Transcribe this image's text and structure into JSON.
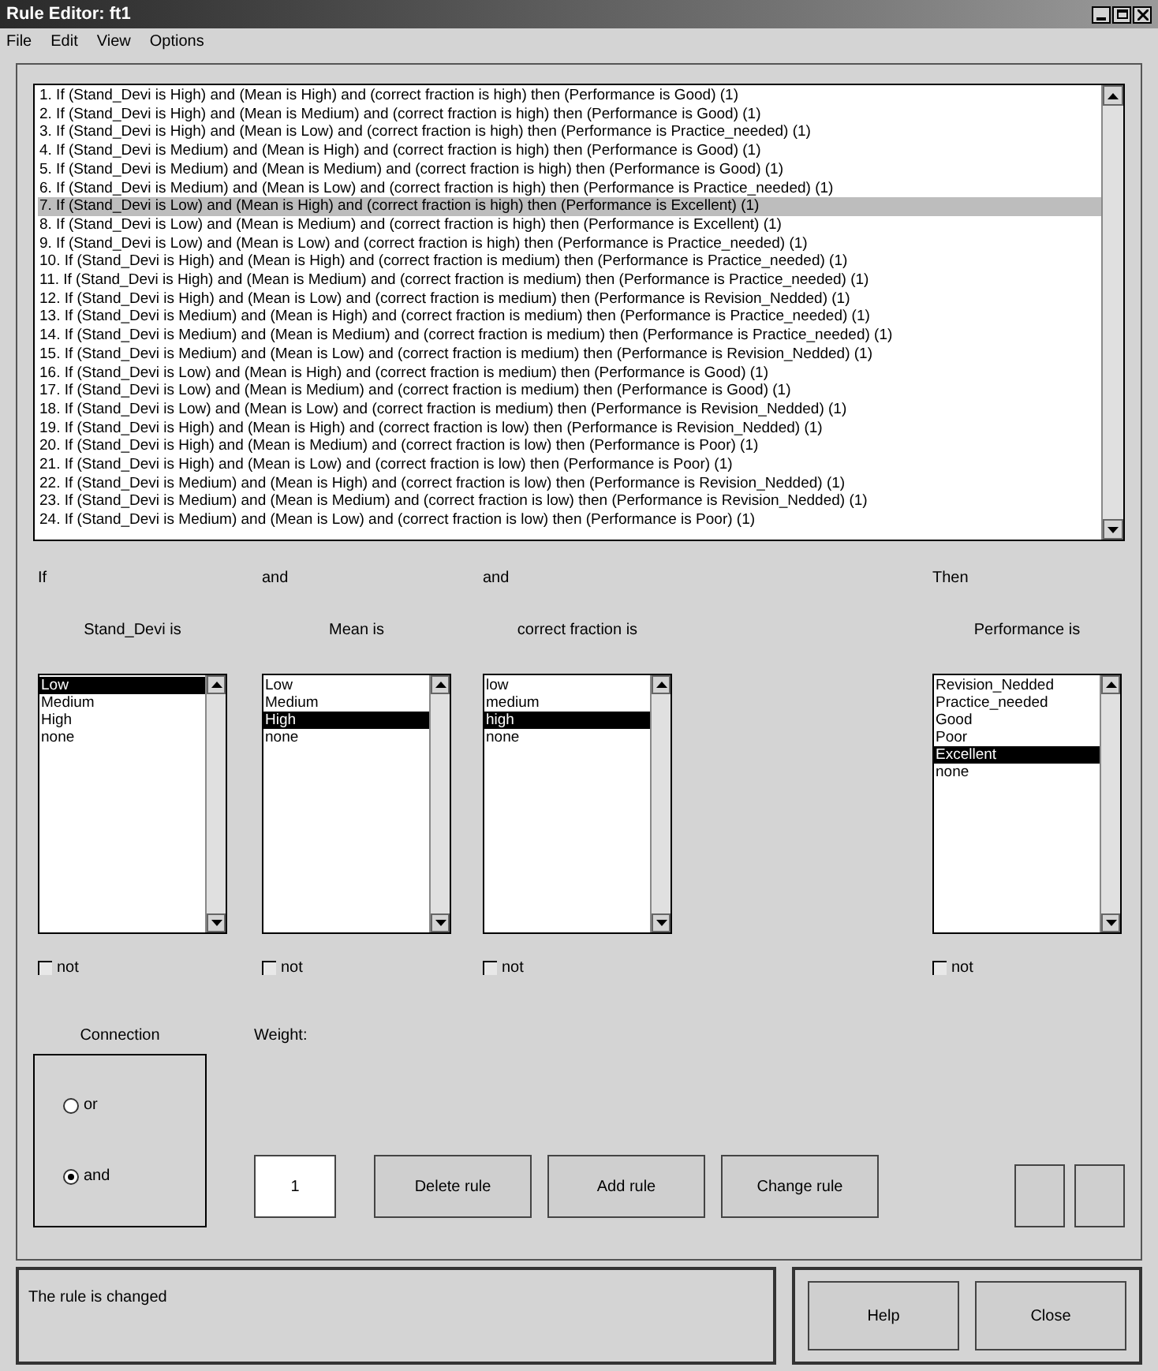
{
  "window": {
    "title": "Rule Editor: ft1"
  },
  "menu": [
    "File",
    "Edit",
    "View",
    "Options"
  ],
  "rules": [
    {
      "text": "1. If (Stand_Devi is High) and (Mean is High) and (correct fraction is high) then (Performance is Good) (1)",
      "selected": false
    },
    {
      "text": "2. If (Stand_Devi is High) and (Mean is Medium) and (correct fraction is high) then (Performance is Good) (1)",
      "selected": false
    },
    {
      "text": "3. If (Stand_Devi is High) and (Mean is Low) and (correct fraction is high) then (Performance is Practice_needed) (1)",
      "selected": false
    },
    {
      "text": "4. If (Stand_Devi is Medium) and (Mean is High) and (correct fraction is high) then (Performance is Good) (1)",
      "selected": false
    },
    {
      "text": "5. If (Stand_Devi is Medium) and (Mean is Medium) and (correct fraction is high) then (Performance is Good) (1)",
      "selected": false
    },
    {
      "text": "6. If (Stand_Devi is Medium) and (Mean is Low) and (correct fraction is high) then (Performance is Practice_needed) (1)",
      "selected": false
    },
    {
      "text": "7. If (Stand_Devi is Low) and (Mean is High) and (correct fraction is high) then (Performance is Excellent) (1)",
      "selected": true
    },
    {
      "text": "8. If (Stand_Devi is Low) and (Mean is Medium) and (correct fraction is high) then (Performance is Excellent) (1)",
      "selected": false
    },
    {
      "text": "9. If (Stand_Devi is Low) and (Mean is Low) and (correct fraction is high) then (Performance is Practice_needed) (1)",
      "selected": false
    },
    {
      "text": "10. If (Stand_Devi is High) and (Mean is High) and (correct fraction is medium) then (Performance is Practice_needed) (1)",
      "selected": false
    },
    {
      "text": "11. If (Stand_Devi is High) and (Mean is Medium) and (correct fraction is medium) then (Performance is Practice_needed) (1)",
      "selected": false
    },
    {
      "text": "12. If (Stand_Devi is High) and (Mean is Low) and (correct fraction is medium) then (Performance is Revision_Nedded) (1)",
      "selected": false
    },
    {
      "text": "13. If (Stand_Devi is Medium) and (Mean is High) and (correct fraction is medium) then (Performance is Practice_needed) (1)",
      "selected": false
    },
    {
      "text": "14. If (Stand_Devi is Medium) and (Mean is Medium) and (correct fraction is medium) then (Performance is Practice_needed) (1)",
      "selected": false
    },
    {
      "text": "15. If (Stand_Devi is Medium) and (Mean is Low) and (correct fraction is medium) then (Performance is Revision_Nedded) (1)",
      "selected": false
    },
    {
      "text": "16. If (Stand_Devi is Low) and (Mean is High) and (correct fraction is medium) then (Performance is Good) (1)",
      "selected": false
    },
    {
      "text": "17. If (Stand_Devi is Low) and (Mean is Medium) and (correct fraction is medium) then (Performance is Good) (1)",
      "selected": false
    },
    {
      "text": "18. If (Stand_Devi is Low) and (Mean is Low) and (correct fraction is medium) then (Performance is Revision_Nedded) (1)",
      "selected": false
    },
    {
      "text": "19. If (Stand_Devi is High) and (Mean is High) and (correct fraction is low) then (Performance is Revision_Nedded) (1)",
      "selected": false
    },
    {
      "text": "20. If (Stand_Devi is High) and (Mean is Medium) and (correct fraction is low) then (Performance is Poor) (1)",
      "selected": false
    },
    {
      "text": "21. If (Stand_Devi is High) and (Mean is Low) and (correct fraction is low) then (Performance is Poor) (1)",
      "selected": false
    },
    {
      "text": "22. If (Stand_Devi is Medium) and (Mean is High) and (correct fraction is low) then (Performance is Revision_Nedded) (1)",
      "selected": false
    },
    {
      "text": "23. If (Stand_Devi is Medium) and (Mean is Medium) and (correct fraction is low) then (Performance is Revision_Nedded) (1)",
      "selected": false
    },
    {
      "text": "24. If (Stand_Devi is Medium) and (Mean is Low) and (correct fraction is low) then (Performance is Poor) (1)",
      "selected": false
    }
  ],
  "columns": [
    {
      "connector": "If",
      "label": "Stand_Devi is",
      "options": [
        {
          "label": "Low",
          "selected": true
        },
        {
          "label": "Medium",
          "selected": false
        },
        {
          "label": "High",
          "selected": false
        },
        {
          "label": "none",
          "selected": false
        }
      ],
      "not": {
        "label": "not",
        "checked": false
      }
    },
    {
      "connector": "and",
      "label": "Mean is",
      "options": [
        {
          "label": "Low",
          "selected": false
        },
        {
          "label": "Medium",
          "selected": false
        },
        {
          "label": "High",
          "selected": true
        },
        {
          "label": "none",
          "selected": false
        }
      ],
      "not": {
        "label": "not",
        "checked": false
      }
    },
    {
      "connector": "and",
      "label": "correct fraction is",
      "options": [
        {
          "label": "low",
          "selected": false
        },
        {
          "label": "medium",
          "selected": false
        },
        {
          "label": "high",
          "selected": true
        },
        {
          "label": "none",
          "selected": false
        }
      ],
      "not": {
        "label": "not",
        "checked": false
      }
    },
    {
      "connector": "Then",
      "label": "Performance is",
      "options": [
        {
          "label": "Revision_Nedded",
          "selected": false
        },
        {
          "label": "Practice_needed",
          "selected": false
        },
        {
          "label": "Good",
          "selected": false
        },
        {
          "label": "Poor",
          "selected": false
        },
        {
          "label": "Excellent",
          "selected": true
        },
        {
          "label": "none",
          "selected": false
        }
      ],
      "not": {
        "label": "not",
        "checked": false
      }
    }
  ],
  "connection": {
    "title": "Connection",
    "options": [
      {
        "label": "or",
        "selected": false
      },
      {
        "label": "and",
        "selected": true
      }
    ]
  },
  "weight": {
    "label": "Weight:",
    "value": "1"
  },
  "actions": [
    "Delete rule",
    "Add rule",
    "Change rule"
  ],
  "status": "The rule is changed",
  "footer_buttons": [
    "Help",
    "Close"
  ]
}
